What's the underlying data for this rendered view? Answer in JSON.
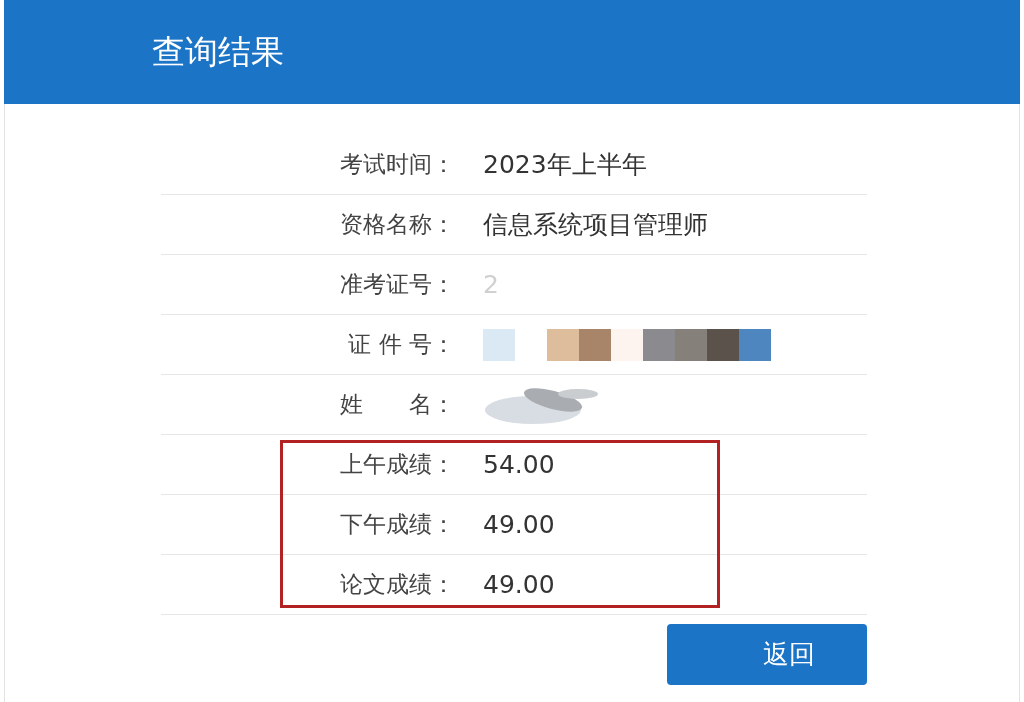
{
  "header": {
    "title": "查询结果"
  },
  "rows": [
    {
      "label": "考试时间：",
      "kind": "text",
      "value": "2023年上半年",
      "highlighted": false
    },
    {
      "label": "资格名称：",
      "kind": "text",
      "value": "信息系统项目管理师",
      "highlighted": false
    },
    {
      "label": "准考证号：",
      "kind": "faded",
      "value": "2",
      "highlighted": false
    },
    {
      "label": "证 件 号：",
      "kind": "mosaic",
      "highlighted": false
    },
    {
      "label": "姓　　名：",
      "kind": "smudge",
      "highlighted": false
    },
    {
      "label": "上午成绩：",
      "kind": "text",
      "value": "54.00",
      "highlighted": true
    },
    {
      "label": "下午成绩：",
      "kind": "text",
      "value": "49.00",
      "highlighted": true
    },
    {
      "label": "论文成绩：",
      "kind": "text",
      "value": "49.00",
      "highlighted": true
    }
  ],
  "button": {
    "label": "返回"
  }
}
